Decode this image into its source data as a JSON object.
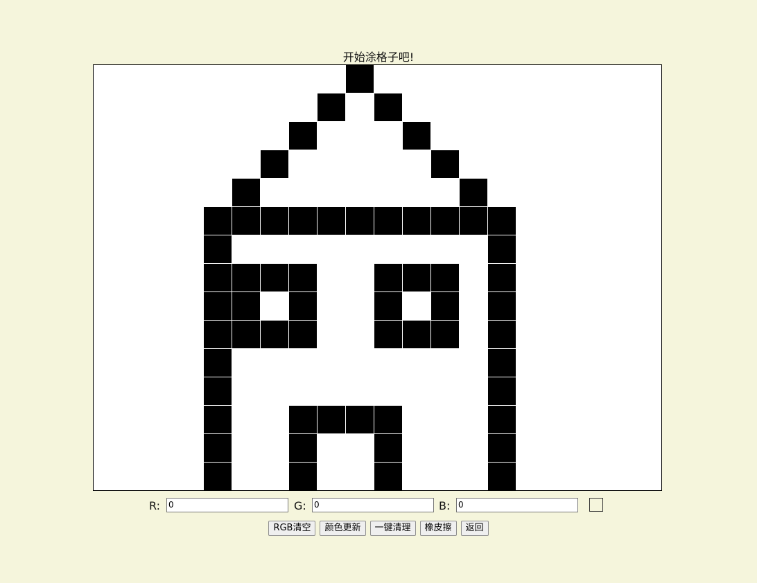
{
  "page": {
    "title": "开始涂格子吧!",
    "background_color": "#f5f5dc"
  },
  "canvas": {
    "background_color": "#ffffff",
    "fill_color": "#000000",
    "grid_line_color": "#ffffff",
    "filled_cells": [
      [
        0,
        9
      ],
      [
        1,
        8
      ],
      [
        1,
        10
      ],
      [
        2,
        7
      ],
      [
        2,
        11
      ],
      [
        3,
        6
      ],
      [
        3,
        12
      ],
      [
        4,
        5
      ],
      [
        4,
        13
      ],
      [
        5,
        4
      ],
      [
        5,
        5
      ],
      [
        5,
        6
      ],
      [
        5,
        7
      ],
      [
        5,
        8
      ],
      [
        5,
        9
      ],
      [
        5,
        10
      ],
      [
        5,
        11
      ],
      [
        5,
        12
      ],
      [
        5,
        13
      ],
      [
        5,
        14
      ],
      [
        6,
        4
      ],
      [
        6,
        14
      ],
      [
        7,
        4
      ],
      [
        7,
        5
      ],
      [
        7,
        6
      ],
      [
        7,
        7
      ],
      [
        7,
        10
      ],
      [
        7,
        11
      ],
      [
        7,
        12
      ],
      [
        7,
        14
      ],
      [
        8,
        4
      ],
      [
        8,
        5
      ],
      [
        8,
        7
      ],
      [
        8,
        10
      ],
      [
        8,
        12
      ],
      [
        8,
        14
      ],
      [
        9,
        4
      ],
      [
        9,
        5
      ],
      [
        9,
        6
      ],
      [
        9,
        7
      ],
      [
        9,
        10
      ],
      [
        9,
        11
      ],
      [
        9,
        12
      ],
      [
        9,
        14
      ],
      [
        10,
        4
      ],
      [
        10,
        14
      ],
      [
        11,
        4
      ],
      [
        11,
        14
      ],
      [
        12,
        4
      ],
      [
        12,
        7
      ],
      [
        12,
        8
      ],
      [
        12,
        9
      ],
      [
        12,
        10
      ],
      [
        12,
        14
      ],
      [
        13,
        4
      ],
      [
        13,
        7
      ],
      [
        13,
        10
      ],
      [
        13,
        14
      ],
      [
        14,
        4
      ],
      [
        14,
        7
      ],
      [
        14,
        10
      ],
      [
        14,
        14
      ]
    ]
  },
  "controls": {
    "r_label": "R:",
    "r_value": "0",
    "g_label": "G:",
    "g_value": "0",
    "b_label": "B:",
    "b_value": "0",
    "preview_color": "#f5f5dc"
  },
  "buttons": {
    "rgb_clear": "RGB清空",
    "color_update": "颜色更新",
    "clear_all": "一键清理",
    "eraser": "橡皮擦",
    "back": "返回"
  }
}
